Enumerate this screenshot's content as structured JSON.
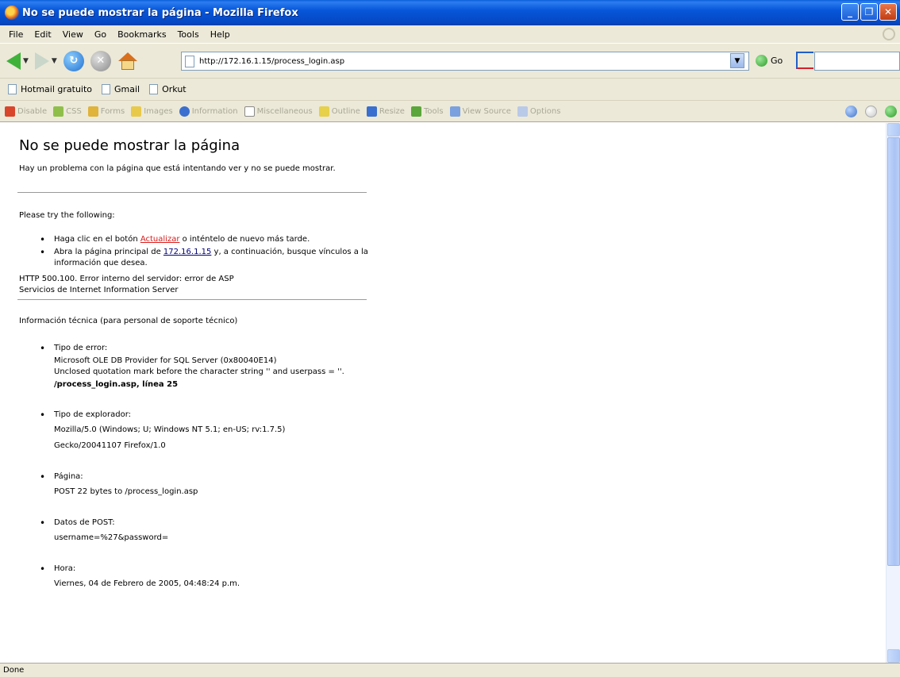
{
  "window": {
    "title": "No se puede mostrar la página - Mozilla Firefox",
    "minimize": "_",
    "maximize": "❐",
    "close": "✕"
  },
  "menubar": {
    "items": [
      "File",
      "Edit",
      "View",
      "Go",
      "Bookmarks",
      "Tools",
      "Help"
    ]
  },
  "navbar": {
    "url": "http://172.16.1.15/process_login.asp",
    "go_label": "Go"
  },
  "bookmarks": {
    "items": [
      "Hotmail gratuito",
      "Gmail",
      "Orkut"
    ]
  },
  "devbar": {
    "items": [
      "Disable",
      "CSS",
      "Forms",
      "Images",
      "Information",
      "Miscellaneous",
      "Outline",
      "Resize",
      "Tools",
      "View Source",
      "Options"
    ]
  },
  "page": {
    "heading": "No se puede mostrar la página",
    "intro": "Hay un problema con la página que está intentando ver y no se puede mostrar.",
    "try_heading": "Please try the following:",
    "suggestion1_before": "Haga clic en el botón ",
    "suggestion1_link": "Actualizar",
    "suggestion1_after": " o inténtelo de nuevo más tarde.",
    "suggestion2_before": "Abra la página principal de ",
    "suggestion2_link": "172.16.1.15",
    "suggestion2_after": " y, a continuación, busque vínculos a la información que desea.",
    "error_line1": "HTTP 500.100. Error interno del servidor: error de ASP",
    "error_line2": "Servicios de Internet Information Server",
    "tech_heading": "Información técnica (para personal de soporte técnico)",
    "tech": {
      "error_type_label": "Tipo de error:",
      "error_type_line1": "Microsoft OLE DB Provider for SQL Server (0x80040E14)",
      "error_type_line2": "Unclosed quotation mark before the character string '' and userpass = ''.",
      "error_type_location": "/process_login.asp, línea 25",
      "browser_label": "Tipo de explorador:",
      "browser_line1": "Mozilla/5.0 (Windows; U; Windows NT 5.1; en-US; rv:1.7.5)",
      "browser_line2": "Gecko/20041107 Firefox/1.0",
      "page_label": "Página:",
      "page_value": "POST 22 bytes to /process_login.asp",
      "post_label": "Datos de POST:",
      "post_value": "username=%27&password=",
      "time_label": "Hora:",
      "time_value": "Viernes, 04 de Febrero de 2005, 04:48:24 p.m."
    }
  },
  "status": {
    "text": "Done"
  }
}
